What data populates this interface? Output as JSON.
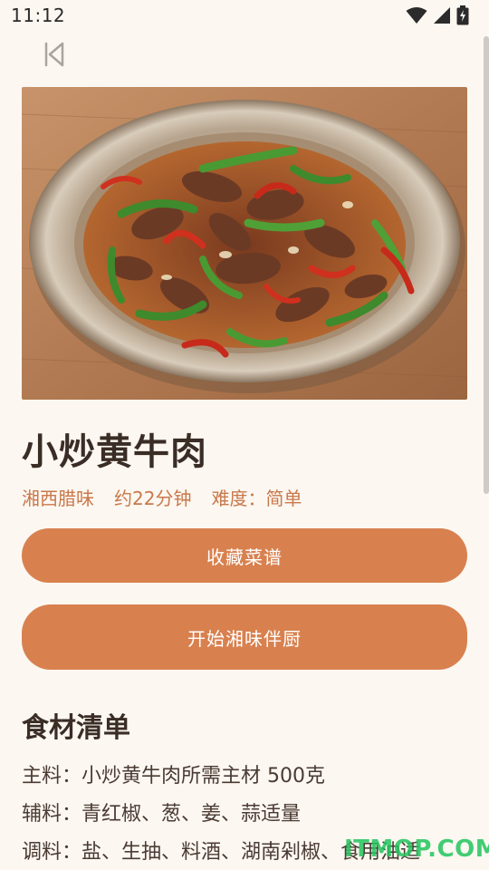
{
  "status_bar": {
    "time": "11:12"
  },
  "recipe": {
    "title": "小炒黄牛肉",
    "cuisine": "湘西腊味",
    "time": "约22分钟",
    "difficulty": "难度：简单"
  },
  "actions": {
    "favorite_label": "收藏菜谱",
    "start_cooking_label": "开始湘味伴厨"
  },
  "ingredients": {
    "title": "食材清单",
    "lines": [
      "主料：小炒黄牛肉所需主材 500克",
      "辅料：青红椒、葱、姜、蒜适量",
      "调料：盐、生抽、料酒、湖南剁椒、食用油适"
    ]
  },
  "watermark": "ITMOP.COM",
  "colors": {
    "background": "#fcf7f1",
    "accent": "#d8814f",
    "meta_text": "#c9784a",
    "title_text": "#3a2d26"
  },
  "icons": {
    "back": "skip-back-icon",
    "wifi": "wifi-icon",
    "signal": "signal-icon",
    "battery": "battery-charging-icon"
  }
}
